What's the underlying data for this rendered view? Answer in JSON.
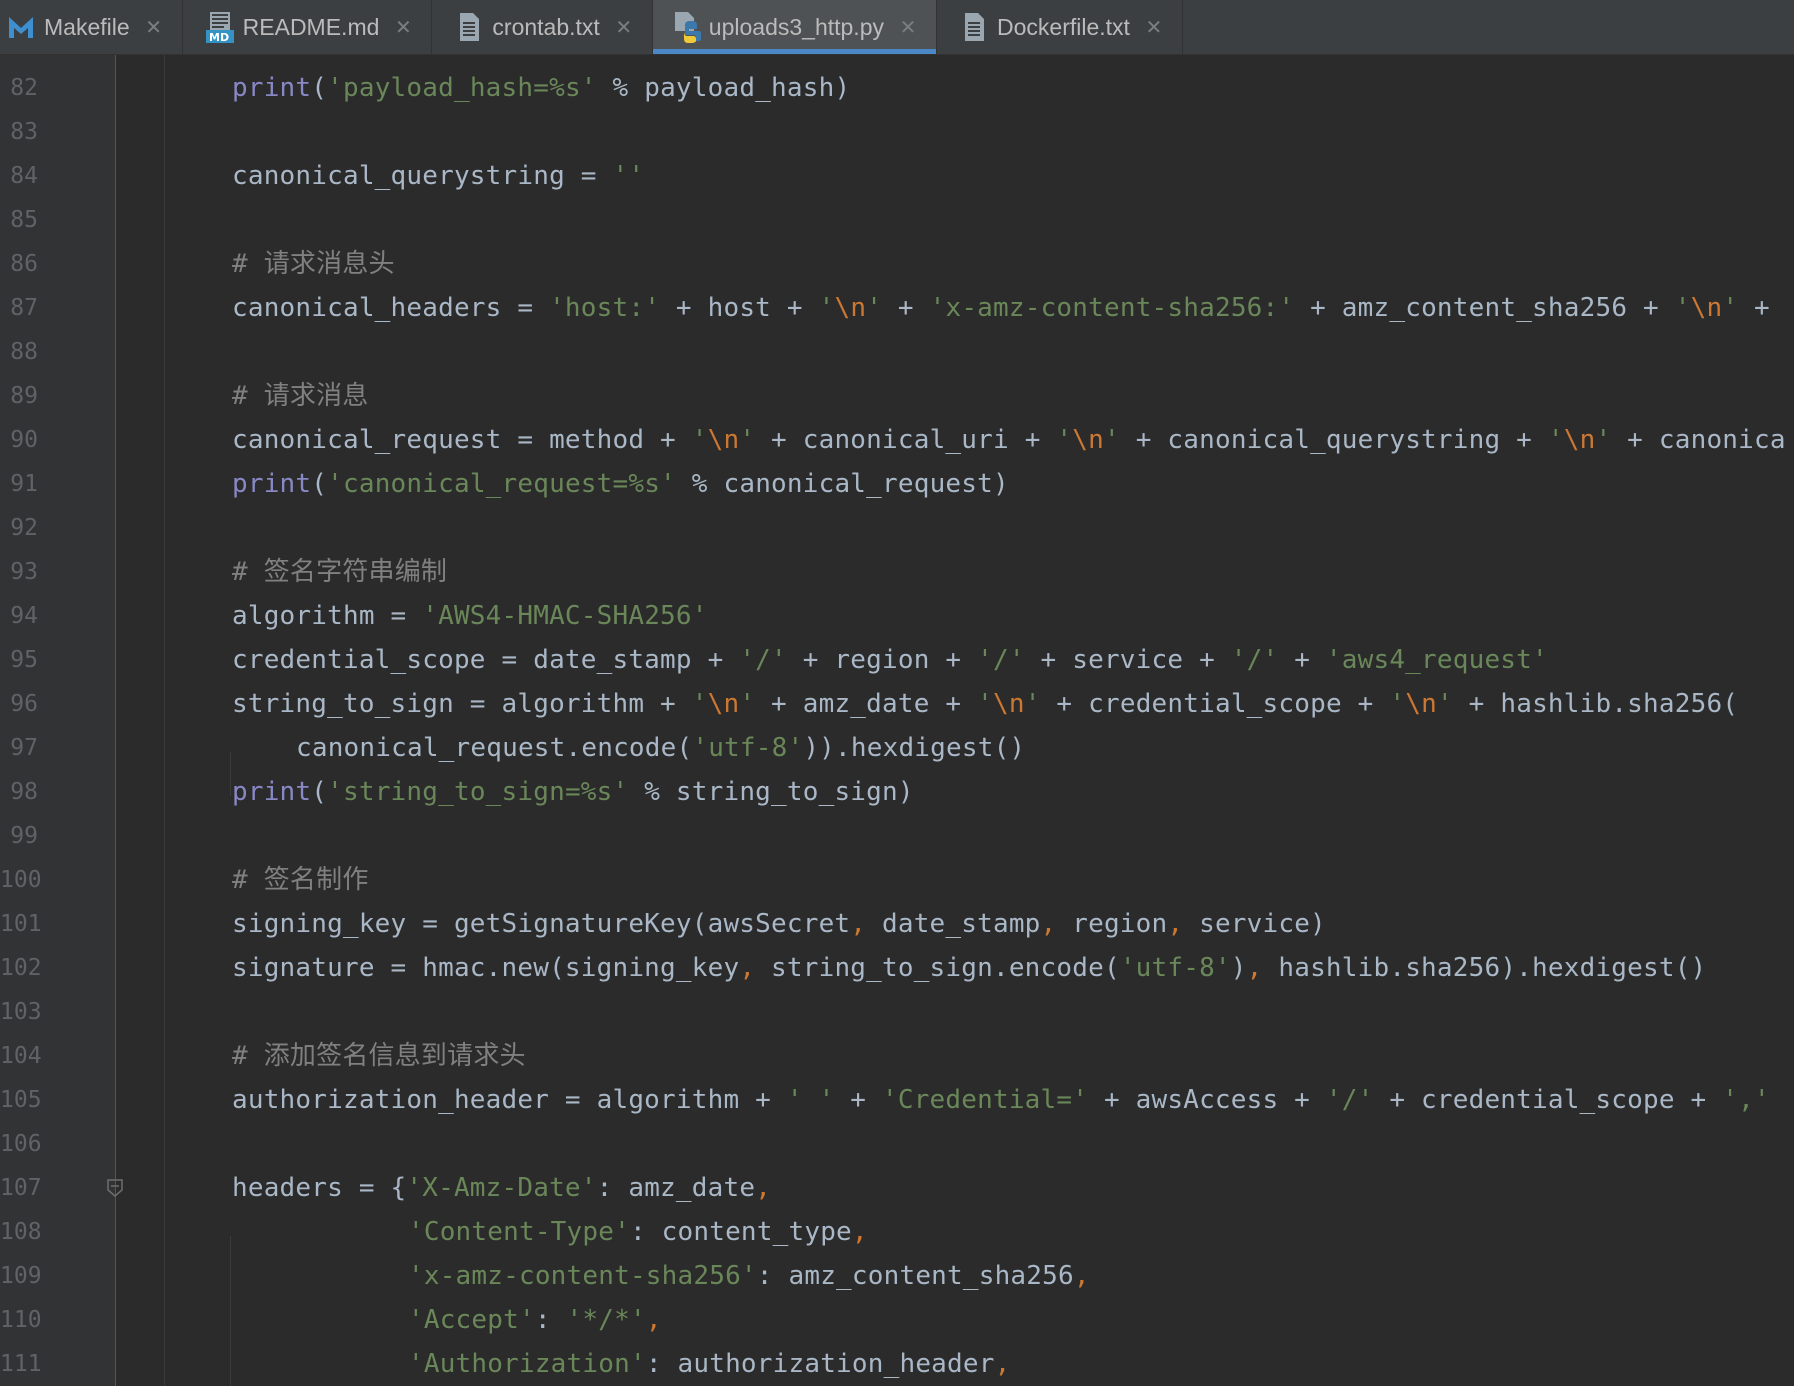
{
  "tabs": [
    {
      "label": "Makefile",
      "icon": "makefile-icon",
      "active": false
    },
    {
      "label": "README.md",
      "icon": "markdown-icon",
      "active": false
    },
    {
      "label": "crontab.txt",
      "icon": "text-file-icon",
      "active": false
    },
    {
      "label": "uploads3_http.py",
      "icon": "python-icon",
      "active": true
    },
    {
      "label": "Dockerfile.txt",
      "icon": "text-file-icon",
      "active": false
    }
  ],
  "colors": {
    "background": "#2b2b2b",
    "tab_bar": "#3c3f41",
    "active_tab": "#4e5254",
    "active_underline": "#4a88c7",
    "string": "#6a8759",
    "keyword": "#cc7832",
    "builtin": "#8888c6",
    "comment": "#808080",
    "identifier": "#a9b7c6",
    "line_number": "#606366"
  },
  "editor": {
    "lines": [
      {
        "number": "82",
        "text": "print('payload_hash=%s' % payload_hash)"
      },
      {
        "number": "83",
        "text": ""
      },
      {
        "number": "84",
        "text": "canonical_querystring = ''"
      },
      {
        "number": "85",
        "text": ""
      },
      {
        "number": "86",
        "text": "# 请求消息头"
      },
      {
        "number": "87",
        "text": "canonical_headers = 'host:' + host + '\\n' + 'x-amz-content-sha256:' + amz_content_sha256 + '\\n' + "
      },
      {
        "number": "88",
        "text": ""
      },
      {
        "number": "89",
        "text": "# 请求消息"
      },
      {
        "number": "90",
        "text": "canonical_request = method + '\\n' + canonical_uri + '\\n' + canonical_querystring + '\\n' + canonica"
      },
      {
        "number": "91",
        "text": "print('canonical_request=%s' % canonical_request)"
      },
      {
        "number": "92",
        "text": ""
      },
      {
        "number": "93",
        "text": "# 签名字符串编制"
      },
      {
        "number": "94",
        "text": "algorithm = 'AWS4-HMAC-SHA256'"
      },
      {
        "number": "95",
        "text": "credential_scope = date_stamp + '/' + region + '/' + service + '/' + 'aws4_request'"
      },
      {
        "number": "96",
        "text": "string_to_sign = algorithm + '\\n' + amz_date + '\\n' + credential_scope + '\\n' + hashlib.sha256("
      },
      {
        "number": "97",
        "text": "    canonical_request.encode('utf-8')).hexdigest()"
      },
      {
        "number": "98",
        "text": "print('string_to_sign=%s' % string_to_sign)"
      },
      {
        "number": "99",
        "text": ""
      },
      {
        "number": "100",
        "text": "# 签名制作"
      },
      {
        "number": "101",
        "text": "signing_key = getSignatureKey(awsSecret, date_stamp, region, service)"
      },
      {
        "number": "102",
        "text": "signature = hmac.new(signing_key, string_to_sign.encode('utf-8'), hashlib.sha256).hexdigest()"
      },
      {
        "number": "103",
        "text": ""
      },
      {
        "number": "104",
        "text": "# 添加签名信息到请求头"
      },
      {
        "number": "105",
        "text": "authorization_header = algorithm + ' ' + 'Credential=' + awsAccess + '/' + credential_scope + ','"
      },
      {
        "number": "106",
        "text": ""
      },
      {
        "number": "107",
        "text": "headers = {'X-Amz-Date': amz_date,"
      },
      {
        "number": "108",
        "text": "           'Content-Type': content_type,"
      },
      {
        "number": "109",
        "text": "           'x-amz-content-sha256': amz_content_sha256,"
      },
      {
        "number": "110",
        "text": "           'Accept': '*/*',"
      },
      {
        "number": "111",
        "text": "           'Authorization': authorization_header,"
      }
    ]
  }
}
